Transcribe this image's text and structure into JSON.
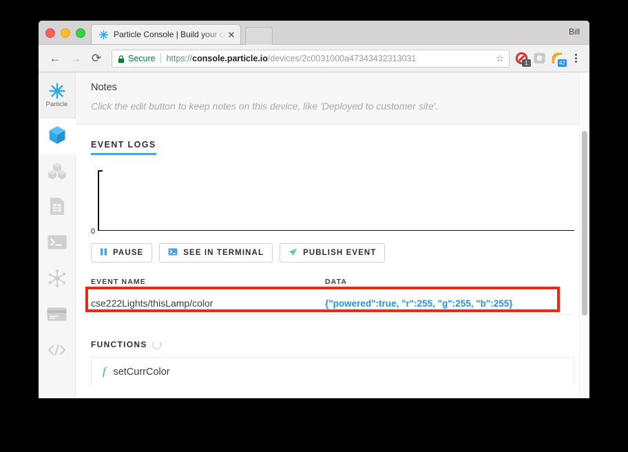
{
  "window": {
    "user_label": "Bill",
    "tab": {
      "title": "Particle Console | Build your co",
      "close_label": "✕",
      "favicon": "particle-star-icon"
    }
  },
  "toolbar": {
    "back_label": "←",
    "forward_label": "→",
    "reload_label": "⟳",
    "secure_label": "Secure",
    "url": {
      "scheme": "https://",
      "host": "console.particle.io",
      "path": "/devices/2c0031000a47343432313031",
      "full": "https://console.particle.io/devices/2c0031000a47343432313031"
    },
    "bookmark_label": "☆",
    "extensions": [
      {
        "name": "adblock-extension-icon",
        "badge": "1",
        "badge_color": "#5c5c5c",
        "color": "#e02b20"
      },
      {
        "name": "pocket-extension-icon",
        "badge": "",
        "badge_color": "",
        "color": "#c9c9c9"
      },
      {
        "name": "feed-extension-icon",
        "badge": "42",
        "badge_color": "#2e8fe8",
        "color": "#f5a623"
      }
    ],
    "menu_label": "chrome-menu"
  },
  "sidebar": {
    "brand": {
      "name": "particle-logo",
      "label": "Particle"
    },
    "items": [
      {
        "name": "sidebar-item-devices",
        "icon": "cube-icon",
        "active": true
      },
      {
        "name": "sidebar-item-integrations",
        "icon": "cubes-icon",
        "active": false
      },
      {
        "name": "sidebar-item-sim-cards",
        "icon": "sim-card-icon",
        "active": false
      },
      {
        "name": "sidebar-item-console",
        "icon": "terminal-icon",
        "active": false
      },
      {
        "name": "sidebar-item-mesh",
        "icon": "network-nodes-icon",
        "active": false
      },
      {
        "name": "sidebar-item-billing",
        "icon": "credit-card-icon",
        "active": false
      },
      {
        "name": "sidebar-item-docs",
        "icon": "code-brackets-icon",
        "active": false
      }
    ]
  },
  "notes": {
    "title": "Notes",
    "placeholder": "Click the edit button to keep notes on this device, like 'Deployed to customer site'."
  },
  "event_logs": {
    "heading": "EVENT LOGS",
    "chart": {
      "y_zero_label": "0"
    },
    "buttons": [
      {
        "name": "pause-button",
        "label": "PAUSE",
        "icon": "pause-icon",
        "icon_color": "#4aa3e3"
      },
      {
        "name": "see-in-terminal-button",
        "label": "SEE IN TERMINAL",
        "icon": "terminal-icon",
        "icon_color": "#4aa3e3"
      },
      {
        "name": "publish-event-button",
        "label": "PUBLISH EVENT",
        "icon": "paper-plane-icon",
        "icon_color": "#3fc47f"
      }
    ],
    "table": {
      "columns": [
        "EVENT NAME",
        "DATA"
      ],
      "rows": [
        {
          "event_name": "cse222Lights/thisLamp/color",
          "data": "{\"powered\":true, \"r\":255, \"g\":255, \"b\":255}"
        }
      ]
    },
    "annotation_color": "#ed2a0c"
  },
  "functions": {
    "heading": "FUNCTIONS",
    "refresh_icon": "refresh-icon",
    "items": [
      {
        "glyph": "f",
        "name": "setCurrColor"
      }
    ]
  },
  "chart_data": {
    "type": "line",
    "title": "EVENT LOGS",
    "x": [],
    "values": [],
    "ylabel": "",
    "xlabel": "",
    "ytick_labels": [
      "0"
    ],
    "ylim": [
      0,
      1
    ],
    "grid": false,
    "legend": "none"
  }
}
